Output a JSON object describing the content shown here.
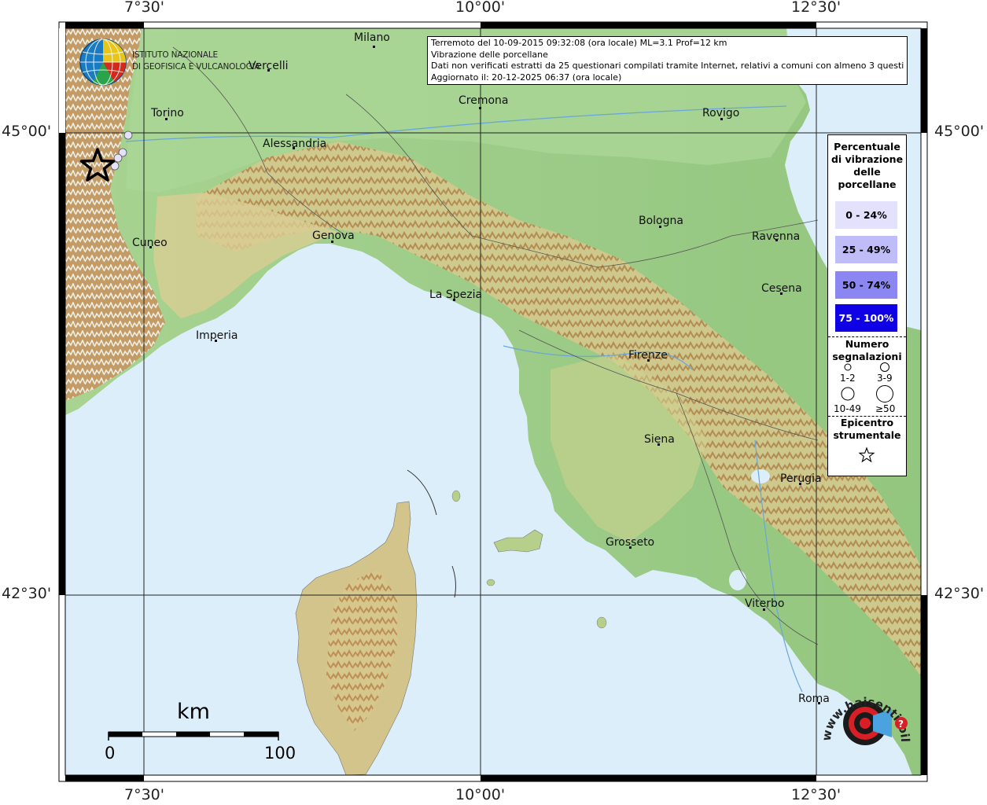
{
  "map": {
    "axis_labels": {
      "lon": [
        "7°30'",
        "10°00'",
        "12°30'"
      ],
      "lat": [
        "45°00'",
        "42°30'"
      ]
    },
    "colors": {
      "sea": "#dceefa",
      "land_low": "#9fd08e",
      "land_mid": "#e3dba0",
      "land_high": "#c08a52",
      "frame": "#000000"
    },
    "cities": [
      {
        "name": "Milano"
      },
      {
        "name": "Vercelli"
      },
      {
        "name": "Torino"
      },
      {
        "name": "Cremona"
      },
      {
        "name": "Rovigo"
      },
      {
        "name": "Alessandria"
      },
      {
        "name": "Bologna"
      },
      {
        "name": "Ravenna"
      },
      {
        "name": "Cuneo"
      },
      {
        "name": "Genova"
      },
      {
        "name": "Cesena"
      },
      {
        "name": "La Spezia"
      },
      {
        "name": "Imperia"
      },
      {
        "name": "Firenze"
      },
      {
        "name": "Siena"
      },
      {
        "name": "Perugia"
      },
      {
        "name": "Grosseto"
      },
      {
        "name": "Viterbo"
      },
      {
        "name": "Roma"
      }
    ],
    "epicenter": {
      "icon": "star-icon"
    },
    "reports": [
      {
        "class": "0 - 24%",
        "size": "1-2"
      },
      {
        "class": "0 - 24%",
        "size": "1-2"
      },
      {
        "class": "0 - 24%",
        "size": "1-2"
      },
      {
        "class": "0 - 24%",
        "size": "1-2"
      }
    ]
  },
  "info": {
    "line1": "Terremoto del 10-09-2015 09:32:08 (ora locale) ML=3.1 Prof=12 km",
    "line2": "Vibrazione delle porcellane",
    "line3": "Dati non verificati estratti da 25 questionari compilati tramite Internet, relativi a comuni con almeno 3 questionari.",
    "line4": "Aggiornato il: 20-12-2025 06:37 (ora locale)"
  },
  "legend": {
    "title": [
      "Percentuale",
      "di vibrazione",
      "delle",
      "porcellane"
    ],
    "classes": [
      {
        "label": "0 - 24%",
        "color": "#e3e1fb",
        "text_color": "#000000"
      },
      {
        "label": "25 - 49%",
        "color": "#c0bcf7",
        "text_color": "#000000"
      },
      {
        "label": "50 - 74%",
        "color": "#8c86f2",
        "text_color": "#000000"
      },
      {
        "label": "75 - 100%",
        "color": "#0f00e6",
        "text_color": "#ffffff"
      }
    ],
    "count_title": [
      "Numero",
      "segnalazioni"
    ],
    "counts": [
      "1-2",
      "3-9",
      "10-49",
      "≥50"
    ],
    "epicenter_title": [
      "Epicentro",
      "strumentale"
    ]
  },
  "logo": {
    "ingv_line1": "ISTITUTO NAZIONALE",
    "ingv_line2": "DI GEOFISICA E VULCANOLOGIA",
    "hst_text": "www.haisentitoilterremoto.it"
  },
  "scalebar": {
    "unit": "km",
    "start": "0",
    "end": "100"
  }
}
